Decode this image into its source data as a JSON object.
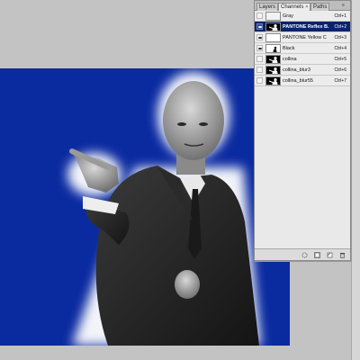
{
  "document": {
    "background_color": "#0a2aa0",
    "image_description_icon": "man-in-suit-pointing-photo"
  },
  "panel": {
    "tabs": [
      {
        "label": "Layers",
        "active": false
      },
      {
        "label": "Channels",
        "active": true
      },
      {
        "label": "Paths",
        "active": false
      }
    ],
    "close_glyph": "×",
    "menu_glyph": "≡",
    "channels": [
      {
        "name": "Gray",
        "shortcut": "Ctrl+1",
        "visible": false,
        "selected": false,
        "thumb": "gray"
      },
      {
        "name": "PANTONE Reflex B...",
        "shortcut": "Ctrl+2",
        "visible": true,
        "selected": true,
        "thumb": "figure"
      },
      {
        "name": "PANTONE Yellow C",
        "shortcut": "Ctrl+3",
        "visible": true,
        "selected": false,
        "thumb": "blank"
      },
      {
        "name": "Black",
        "shortcut": "Ctrl+4",
        "visible": true,
        "selected": false,
        "thumb": "figure-small"
      },
      {
        "name": "collina",
        "shortcut": "Ctrl+5",
        "visible": false,
        "selected": false,
        "thumb": "figure"
      },
      {
        "name": "collina_blur3",
        "shortcut": "Ctrl+6",
        "visible": false,
        "selected": false,
        "thumb": "figure"
      },
      {
        "name": "collina_blur55",
        "shortcut": "Ctrl+7",
        "visible": false,
        "selected": false,
        "thumb": "figure"
      }
    ],
    "footer_icons": [
      "load-selection-icon",
      "save-selection-icon",
      "new-channel-icon",
      "delete-channel-icon"
    ]
  }
}
